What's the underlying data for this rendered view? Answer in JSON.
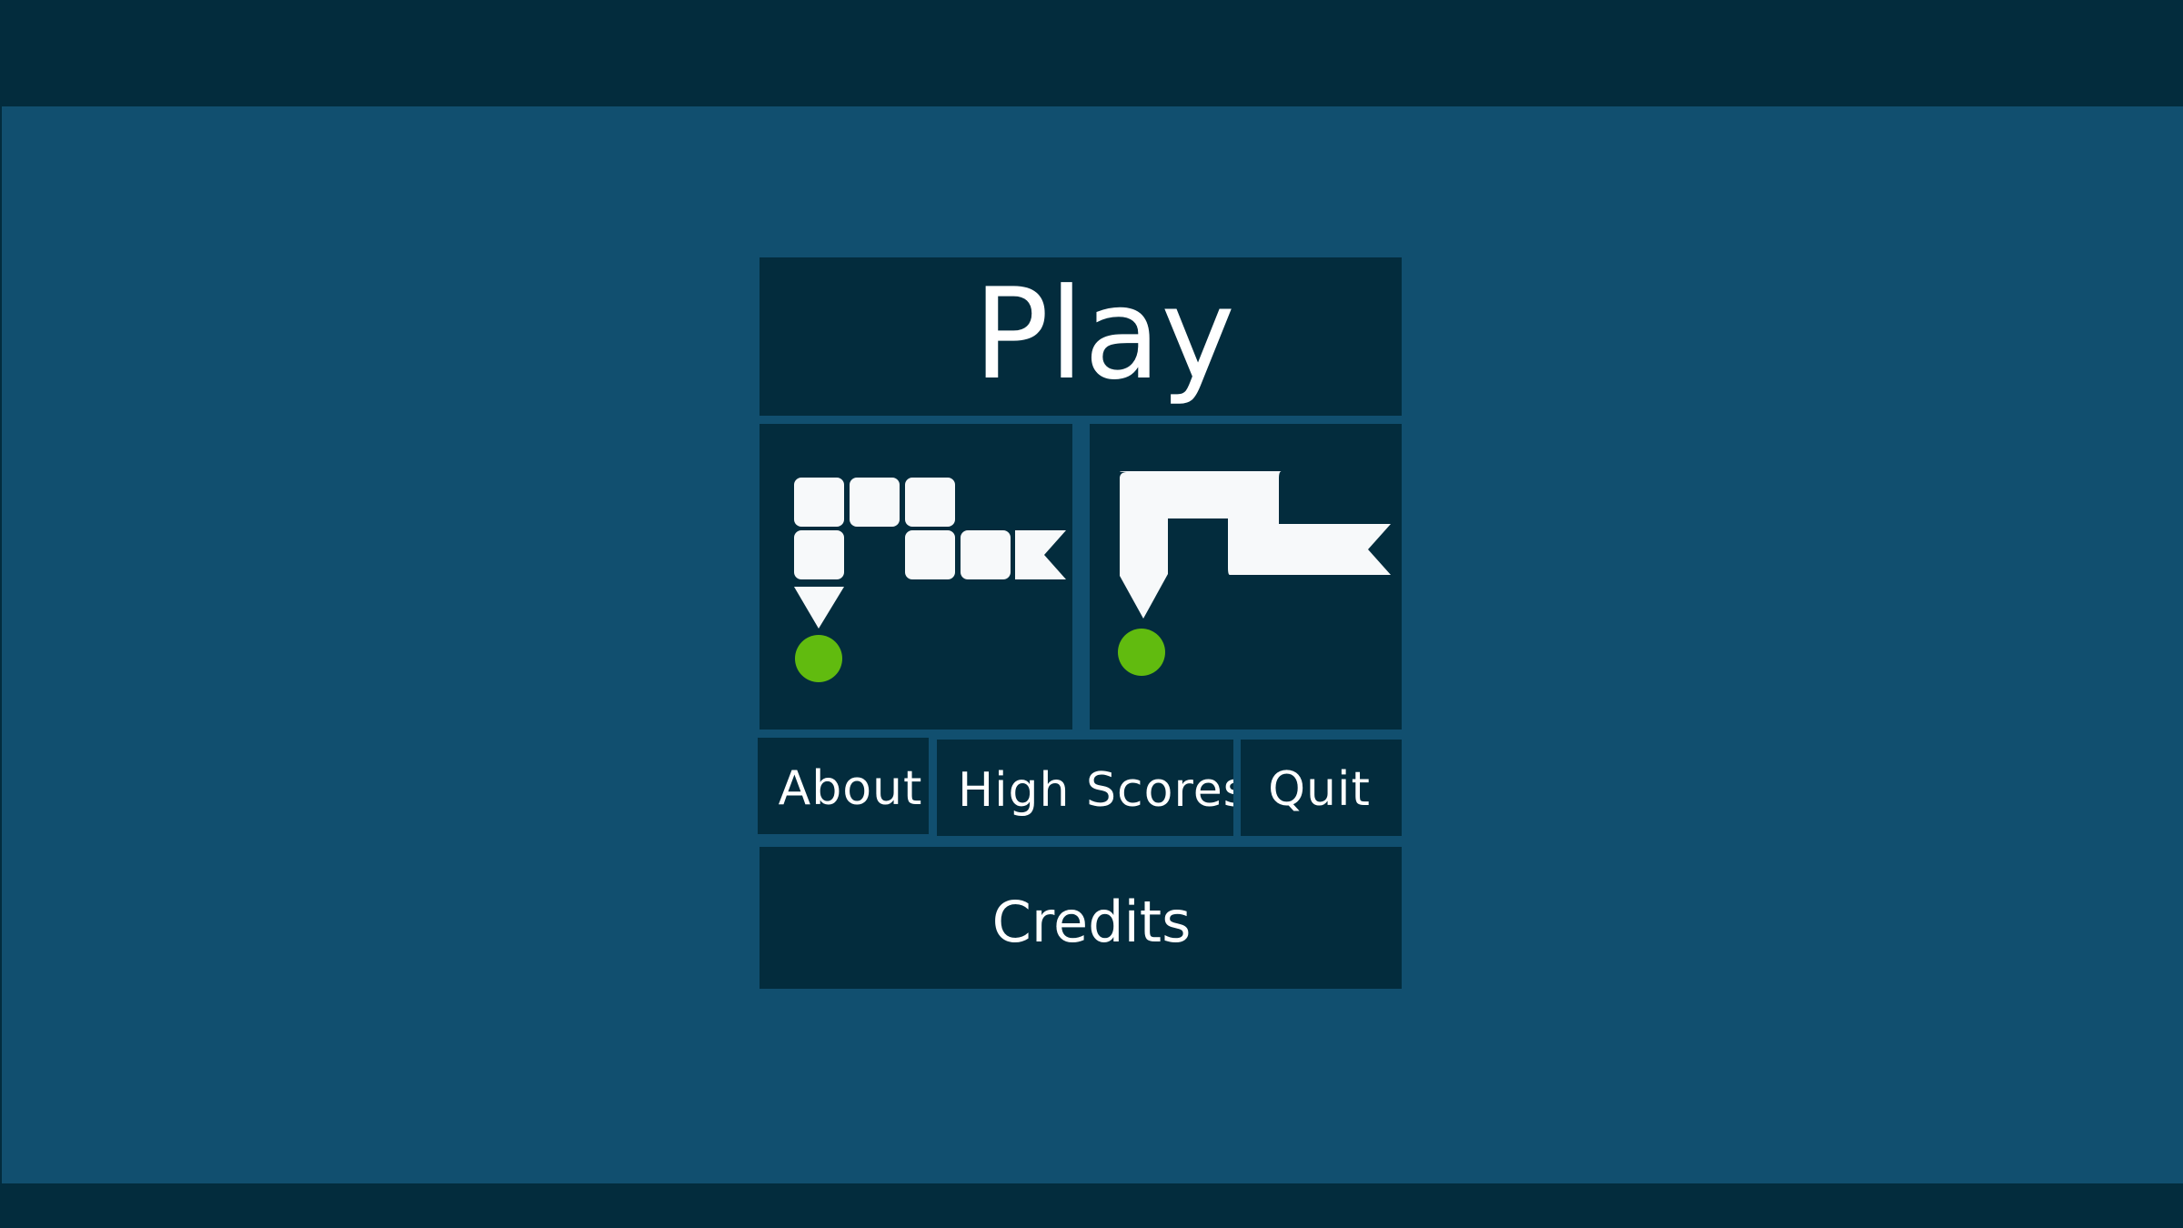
{
  "menu": {
    "play_label": "Play",
    "about_label": "About",
    "high_scores_label": "High Scores",
    "quit_label": "Quit",
    "credits_label": "Credits"
  },
  "modes": [
    {
      "name": "blocks",
      "icon": "segmented-snake-icon"
    },
    {
      "name": "smooth",
      "icon": "continuous-snake-icon"
    }
  ],
  "colors": {
    "frame": "#032c3d",
    "background": "#114f6f",
    "tile": "#032c3d",
    "text": "#ffffff",
    "snake": "#f7f9fa",
    "food": "#61bb0f"
  }
}
